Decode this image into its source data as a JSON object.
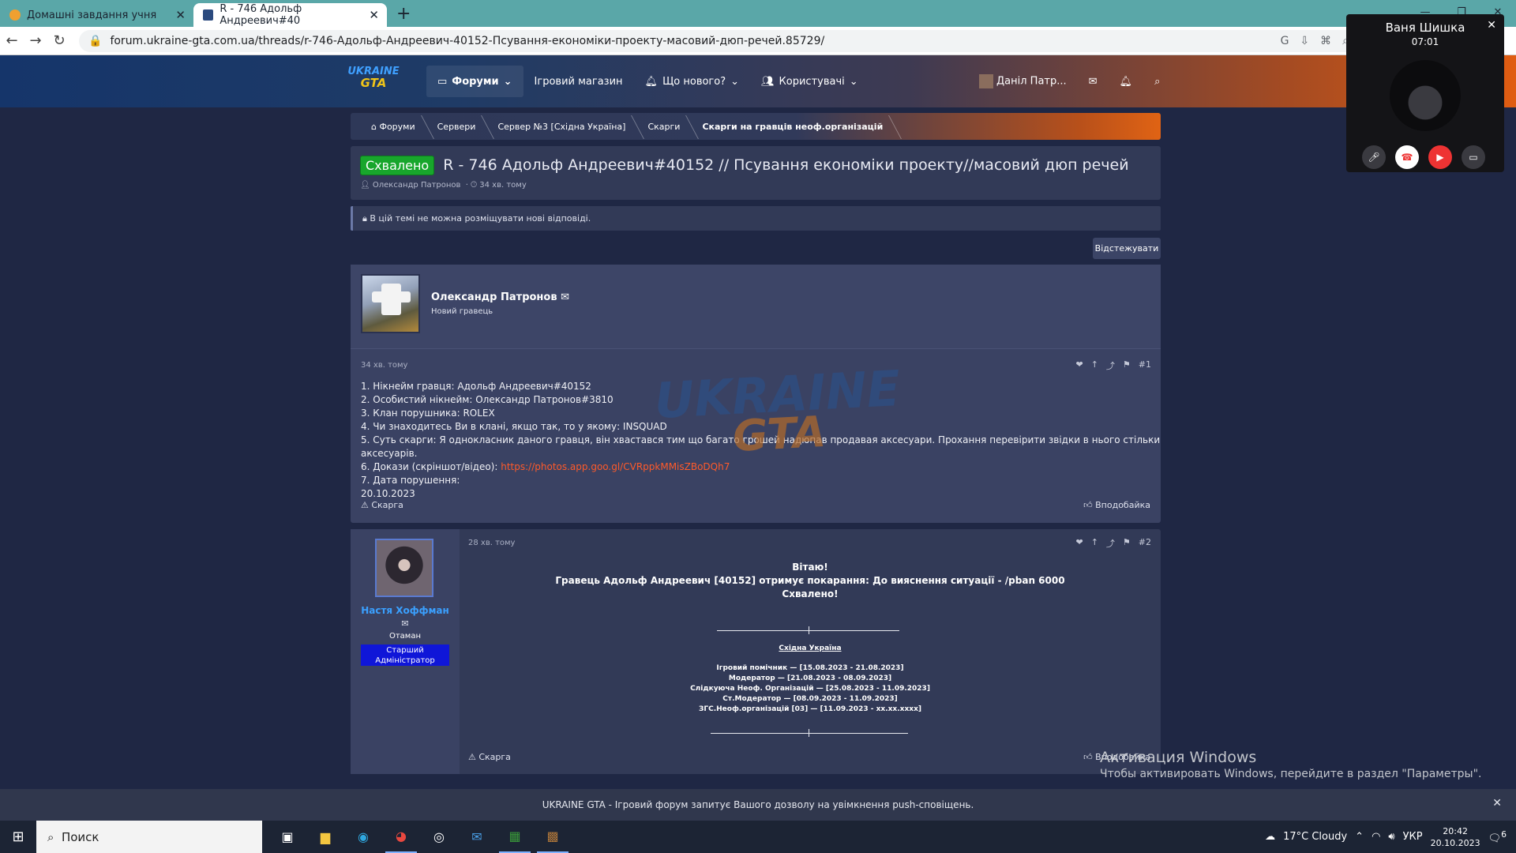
{
  "browser": {
    "tabs": [
      {
        "title": "Домашні завдання учня",
        "active": false
      },
      {
        "title": "R - 746 Адольф Андреевич#40",
        "active": true
      }
    ],
    "url": "forum.ukraine-gta.com.ua/threads/r-746-Адольф-Андреевич-40152-Псування-економіки-проекту-масовий-дюп-речей.85729/"
  },
  "site": {
    "logo_top": "UKRAINE",
    "logo_bottom": "GTA",
    "menu": [
      "Форуми",
      "Ігровий магазин",
      "Що нового?",
      "Користувачі"
    ],
    "user_name": "Даніл Патр..."
  },
  "breadcrumb": [
    "Форуми",
    "Сервери",
    "Сервер №3 [Східна Україна]",
    "Скарги",
    "Скарги на гравців неоф.організацій"
  ],
  "thread": {
    "badge": "Схвалено",
    "title": "R - 746 Адольф Андреевич#40152 // Псування економіки проекту//масовий дюп речей",
    "author": "Олександр Патронов",
    "time": "34 хв. тому",
    "notice": "В цій темі не можна розміщувати нові відповіді.",
    "follow": "Відстежувати"
  },
  "post1": {
    "author": "Олександр Патронов",
    "rank": "Новий гравець",
    "time": "34 хв. тому",
    "num": "#1",
    "lines": [
      "1. Нікнейм гравця: Адольф Андреевич#40152",
      "2. Особистий нікнейм: Олександр Патронов#3810",
      "3. Клан порушника: ROLEX",
      "4. Чи знаходитесь Ви в клані, якщо так, то у якому: INSQUAD",
      "5. Суть скарги: Я однокласник даного гравця, він хвастався тим що багато грошей надюпав продавая аксесуари. Прохання перевірити звідки в нього стільки аксесуарів.",
      "6. Докази (скріншот/відео): ",
      "7. Дата порушення:",
      "20.10.2023"
    ],
    "link": "https://photos.app.goo.gl/CVRppkMMisZBoDQh7",
    "report": "Скарга",
    "like": "Вподобайка"
  },
  "post2": {
    "author": "Настя Хоффман",
    "rank": "Отаман",
    "staff": "Старший Адміністратор",
    "time": "28 хв. тому",
    "num": "#2",
    "greeting": "Вітаю!",
    "verdict": "Гравець Адольф Андреевич [40152] отримує покарання: До вияснення ситуації - /pban 6000",
    "status": "Схвалено!",
    "sig_title": "Східна Україна",
    "sig_lines": [
      "Ігровий помічник — [15.08.2023 - 21.08.2023]",
      "Модератор — [21.08.2023 - 08.09.2023]",
      "Слідкуюча Неоф. Організацій — [25.08.2023 - 11.09.2023]",
      "Ст.Модератор — [08.09.2023 - 11.09.2023]",
      "ЗГС.Неоф.організацій [03] — [11.09.2023 - xx.xx.xxxx]"
    ],
    "report": "Скарга",
    "like": "Вподобайка"
  },
  "call": {
    "name": "Ваня Шишка",
    "time": "07:01"
  },
  "activation": {
    "title": "Активация Windows",
    "text": "Чтобы активировать Windows, перейдите в раздел \"Параметры\"."
  },
  "push": "UKRAINE GTA - Ігровий форум запитує Вашого дозволу на увімкнення push-сповіщень.",
  "taskbar": {
    "search": "Поиск",
    "weather": "17°C  Cloudy",
    "lang": "УКР",
    "time": "20:42",
    "date": "20.10.2023",
    "notif": "6"
  }
}
